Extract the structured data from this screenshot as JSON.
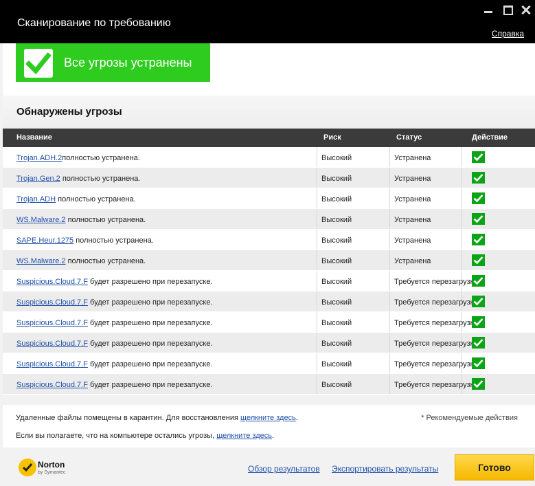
{
  "window": {
    "title": "Сканирование по требованию",
    "help_link": "Справка"
  },
  "banner": {
    "text": "Все угрозы устранены",
    "color": "#2ecc1f"
  },
  "section": {
    "heading": "Обнаружены угрозы"
  },
  "table": {
    "columns": [
      "Название",
      "Риск",
      "Статус",
      "Действие"
    ],
    "rows": [
      {
        "threat": "Trojan.ADH.2",
        "desc": "полностью устранена.",
        "risk": "Высокий",
        "status": "Устранена"
      },
      {
        "threat": "Trojan.Gen.2",
        "desc": " полностью устранена.",
        "risk": "Высокий",
        "status": "Устранена"
      },
      {
        "threat": "Trojan.ADH",
        "desc": " полностью устранена.",
        "risk": "Высокий",
        "status": "Устранена"
      },
      {
        "threat": "WS.Malware.2",
        "desc": " полностью устранена.",
        "risk": "Высокий",
        "status": "Устранена"
      },
      {
        "threat": "SAPE.Heur.1275",
        "desc": " полностью устранена.",
        "risk": "Высокий",
        "status": "Устранена"
      },
      {
        "threat": "WS.Malware.2",
        "desc": " полностью устранена.",
        "risk": "Высокий",
        "status": "Устранена"
      },
      {
        "threat": "Suspicious.Cloud.7.F",
        "desc": " будет разрешено при перезапуске.",
        "risk": "Высокий",
        "status": "Требуется перезагрузк"
      },
      {
        "threat": "Suspicious.Cloud.7.F",
        "desc": " будет разрешено при перезапуске.",
        "risk": "Высокий",
        "status": "Требуется перезагрузк"
      },
      {
        "threat": "Suspicious.Cloud.7.F",
        "desc": " будет разрешено при перезапуске.",
        "risk": "Высокий",
        "status": "Требуется перезагрузк"
      },
      {
        "threat": "Suspicious.Cloud.7.F",
        "desc": " будет разрешено при перезапуске.",
        "risk": "Высокий",
        "status": "Требуется перезагрузк"
      },
      {
        "threat": "Suspicious.Cloud.7.F",
        "desc": " будет разрешено при перезапуске.",
        "risk": "Высокий",
        "status": "Требуется перезагрузк"
      },
      {
        "threat": "Suspicious.Cloud.7.F",
        "desc": " будет разрешено при перезапуске.",
        "risk": "Высокий",
        "status": "Требуется перезагрузк"
      }
    ]
  },
  "info": {
    "line1_text": "Удаленные файлы помещены в карантин. Для восстановления ",
    "line1_link": "щелкните здесь",
    "line1_end": ".",
    "line2_text": "Если вы полагаете, что на компьютере остались угрозы, ",
    "line2_link": "щелкните здесь",
    "line2_end": ".",
    "note": "* Рекомендуемые действия"
  },
  "footer": {
    "brand": "Norton",
    "brand_sub": "by Symantec",
    "review_link": "Обзор результатов",
    "export_link": "Экспортировать результаты",
    "done_button": "Готово"
  }
}
